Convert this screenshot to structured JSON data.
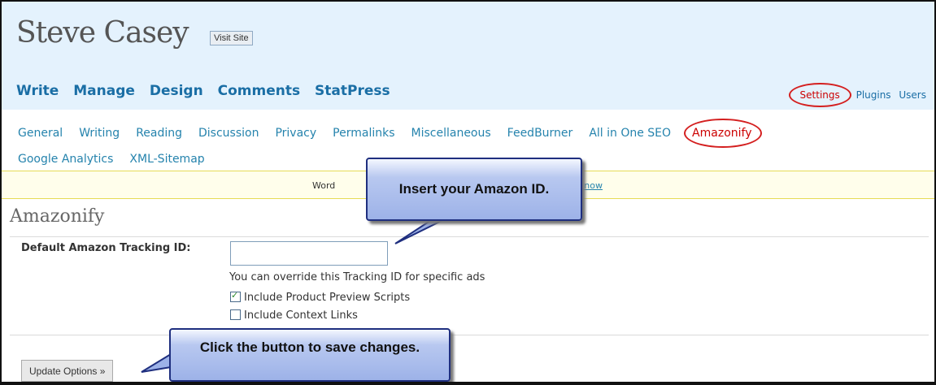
{
  "site": {
    "title": "Steve Casey",
    "visit_site_label": "Visit Site"
  },
  "main_nav": [
    "Write",
    "Manage",
    "Design",
    "Comments",
    "StatPress"
  ],
  "right_nav": {
    "settings": "Settings",
    "plugins": "Plugins",
    "users": "Users"
  },
  "sub_nav": [
    "General",
    "Writing",
    "Reading",
    "Discussion",
    "Privacy",
    "Permalinks",
    "Miscellaneous",
    "FeedBurner",
    "All in One SEO"
  ],
  "sub_nav_active": "Amazonify",
  "sub_nav_row2": [
    "Google Analytics",
    "XML-Sitemap"
  ],
  "notice": {
    "lead": "Word",
    "link": "e now"
  },
  "page": {
    "title": "Amazonify",
    "tracking_label": "Default Amazon Tracking ID:",
    "tracking_value": "",
    "hint": "You can override this Tracking ID for specific ads",
    "opt_preview": {
      "label": "Include Product Preview Scripts",
      "checked": true
    },
    "opt_context": {
      "label": "Include Context Links",
      "checked": false
    },
    "update_button": "Update Options »"
  },
  "callouts": {
    "amazon_id": "Insert your Amazon ID.",
    "save": "Click the button to save changes."
  },
  "colors": {
    "header_bg": "#e4f2fd",
    "link": "#2583ad",
    "highlight": "#d41f1f",
    "callout": "#9db2e8"
  }
}
